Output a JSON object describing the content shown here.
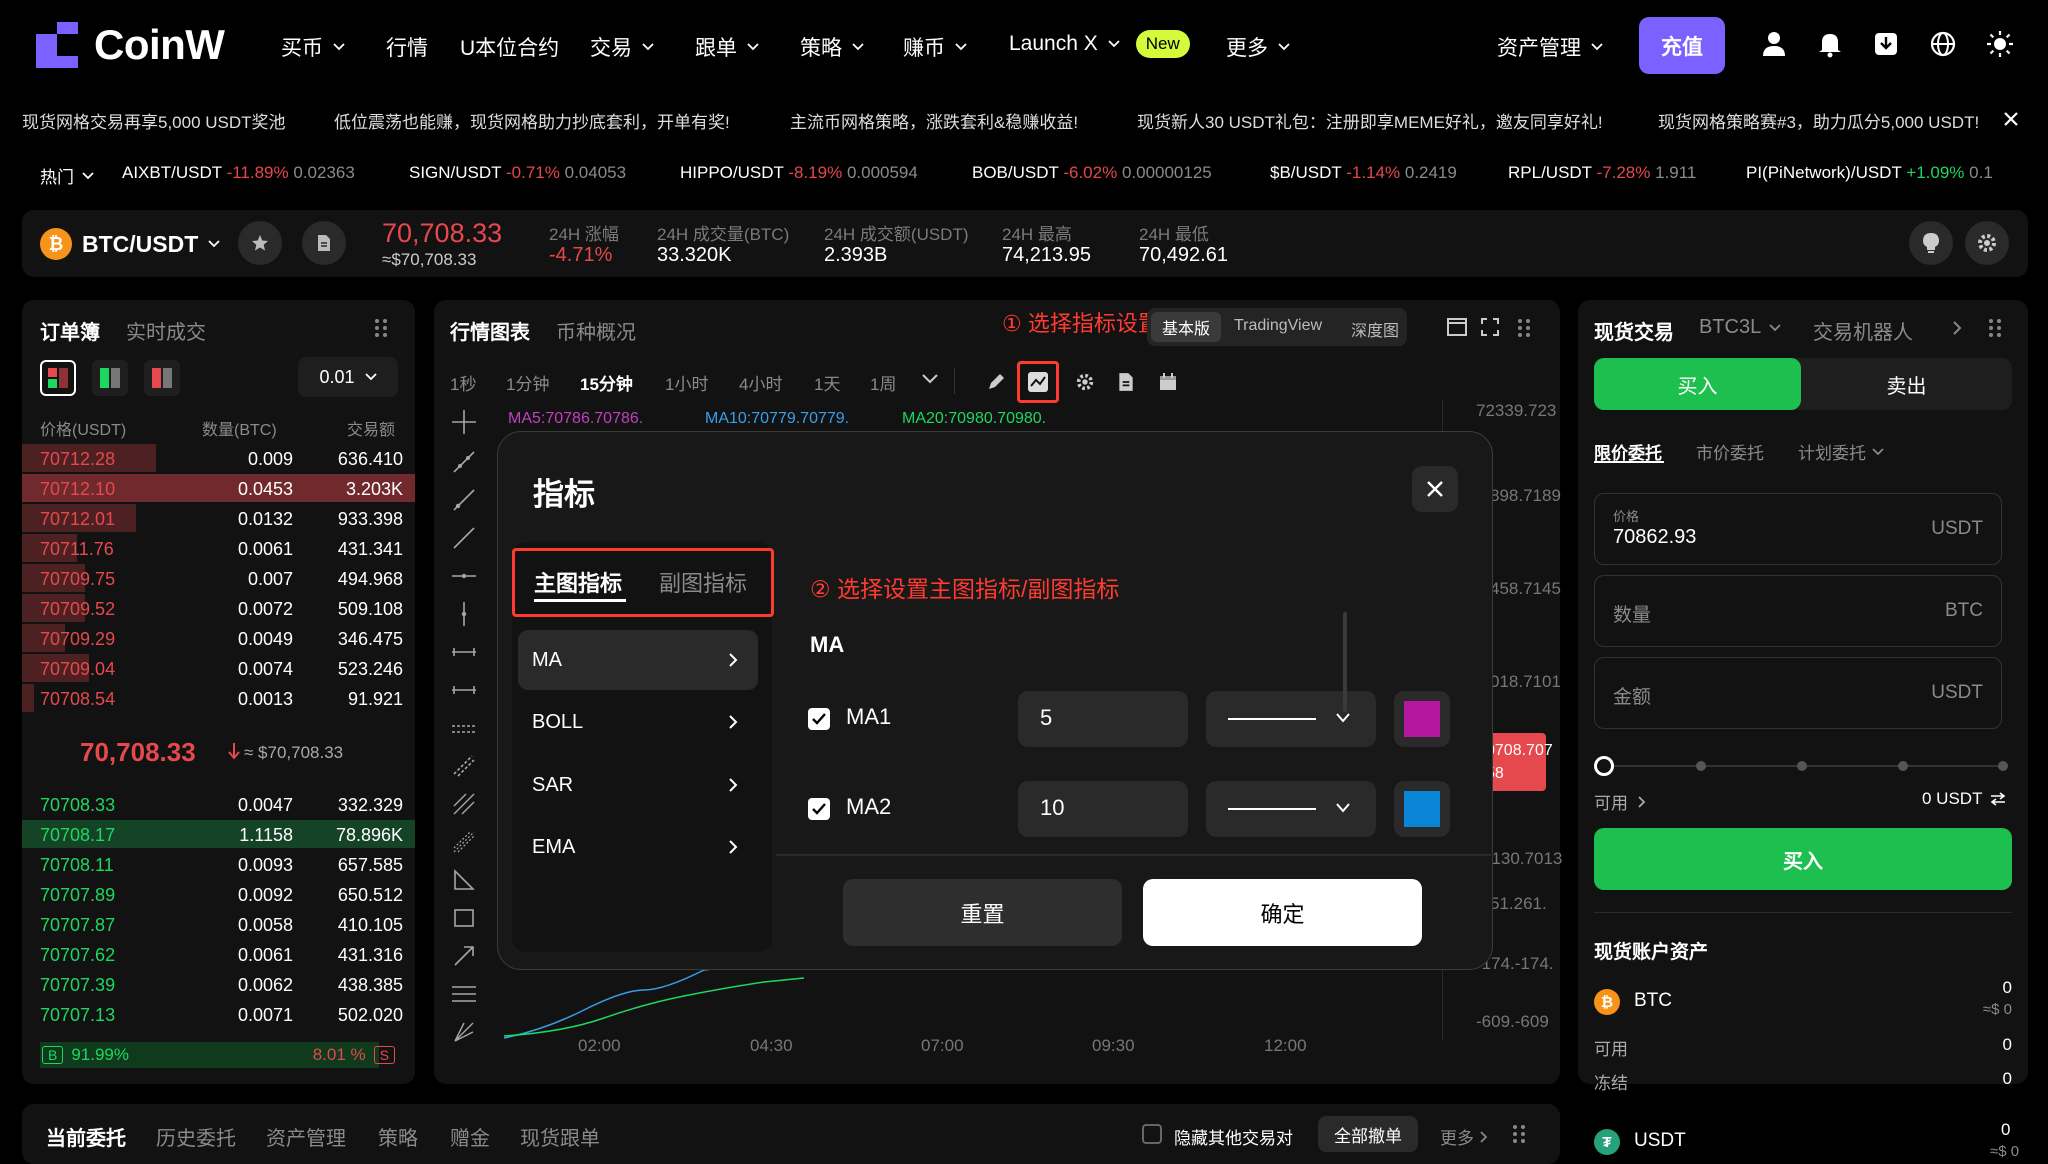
{
  "colors": {
    "accent": "#7b61ff",
    "up": "#1ed760",
    "down": "#e5484d",
    "buy": "#1dbf4f",
    "annotation": "#ff3b30",
    "new_badge": "#d4fa3c"
  },
  "nav": {
    "brand": "CoinW",
    "items": [
      {
        "label": "买币",
        "chevron": true
      },
      {
        "label": "行情",
        "chevron": false
      },
      {
        "label": "U本位合约",
        "chevron": false
      },
      {
        "label": "交易",
        "chevron": true
      },
      {
        "label": "跟单",
        "chevron": true
      },
      {
        "label": "策略",
        "chevron": true
      },
      {
        "label": "赚币",
        "chevron": true
      },
      {
        "label": "Launch X",
        "chevron": true
      },
      {
        "label": "更多",
        "chevron": true
      }
    ],
    "new_badge": "New",
    "asset_mgmt": "资产管理",
    "deposit": "充值",
    "icons": [
      "user-icon",
      "bell-icon",
      "download-icon",
      "globe-icon",
      "sun-icon"
    ]
  },
  "announcements": [
    "现货网格交易再享5,000 USDT奖池",
    "低位震荡也能赚，现货网格助力抄底套利，开单有奖!",
    "主流币网格策略，涨跌套利&稳赚收益!",
    "现货新人30 USDT礼包：注册即享MEME好礼，邀友同享好礼!",
    "现货网格策略赛#3，助力瓜分5,000 USDT!"
  ],
  "hot": {
    "label": "热门",
    "items": [
      {
        "pair": "AIXBT/USDT",
        "change": "-11.89%",
        "price": "0.02363",
        "up": false
      },
      {
        "pair": "SIGN/USDT",
        "change": "-0.71%",
        "price": "0.04053",
        "up": false
      },
      {
        "pair": "HIPPO/USDT",
        "change": "-8.19%",
        "price": "0.000594",
        "up": false
      },
      {
        "pair": "BOB/USDT",
        "change": "-6.02%",
        "price": "0.00000125",
        "up": false
      },
      {
        "pair": "$B/USDT",
        "change": "-1.14%",
        "price": "0.2419",
        "up": false
      },
      {
        "pair": "RPL/USDT",
        "change": "-7.28%",
        "price": "1.911",
        "up": false
      },
      {
        "pair": "PI(PiNetwork)/USDT",
        "change": "+1.09%",
        "price": "0.1",
        "up": true
      }
    ]
  },
  "pair": {
    "symbol": "BTC/USDT",
    "coin_glyph": "₿",
    "price": "70,708.33",
    "price_sub": "≈$70,708.33",
    "stats": [
      {
        "label": "24H 涨幅",
        "value": "-4.71%",
        "color": "down"
      },
      {
        "label": "24H 成交量(BTC)",
        "value": "33.320K",
        "color": "none"
      },
      {
        "label": "24H 成交额(USDT)",
        "value": "2.393B",
        "color": "none"
      },
      {
        "label": "24H 最高",
        "value": "74,213.95",
        "color": "none"
      },
      {
        "label": "24H 最低",
        "value": "70,492.61",
        "color": "none"
      }
    ]
  },
  "orderbook": {
    "tabs": [
      "订单簿",
      "实时成交"
    ],
    "precision": "0.01",
    "headers": [
      "价格(USDT)",
      "数量(BTC)",
      "交易额"
    ],
    "asks": [
      {
        "price": "70712.28",
        "qty": "0.009",
        "amount": "636.410",
        "depth": 0.34
      },
      {
        "price": "70712.10",
        "qty": "0.0453",
        "amount": "3.203K",
        "depth": 1.0
      },
      {
        "price": "70712.01",
        "qty": "0.0132",
        "amount": "933.398",
        "depth": 0.29
      },
      {
        "price": "70711.76",
        "qty": "0.0061",
        "amount": "431.341",
        "depth": 0.14
      },
      {
        "price": "70709.75",
        "qty": "0.007",
        "amount": "494.968",
        "depth": 0.16
      },
      {
        "price": "70709.52",
        "qty": "0.0072",
        "amount": "509.108",
        "depth": 0.16
      },
      {
        "price": "70709.29",
        "qty": "0.0049",
        "amount": "346.475",
        "depth": 0.11
      },
      {
        "price": "70709.04",
        "qty": "0.0074",
        "amount": "523.246",
        "depth": 0.17
      },
      {
        "price": "70708.54",
        "qty": "0.0013",
        "amount": "91.921",
        "depth": 0.03
      }
    ],
    "mid_price": "70,708.33",
    "mid_sub": "≈ $70,708.33",
    "bids": [
      {
        "price": "70708.33",
        "qty": "0.0047",
        "amount": "332.329",
        "depth": 0.0
      },
      {
        "price": "70708.17",
        "qty": "1.1158",
        "amount": "78.896K",
        "depth": 1.0
      },
      {
        "price": "70708.11",
        "qty": "0.0093",
        "amount": "657.585",
        "depth": 0.0
      },
      {
        "price": "70707.89",
        "qty": "0.0092",
        "amount": "650.512",
        "depth": 0.0
      },
      {
        "price": "70707.87",
        "qty": "0.0058",
        "amount": "410.105",
        "depth": 0.0
      },
      {
        "price": "70707.62",
        "qty": "0.0061",
        "amount": "431.316",
        "depth": 0.0
      },
      {
        "price": "70707.39",
        "qty": "0.0062",
        "amount": "438.385",
        "depth": 0.0
      },
      {
        "price": "70707.13",
        "qty": "0.0071",
        "amount": "502.020",
        "depth": 0.0
      }
    ],
    "buy_tag": "B",
    "buy_pct": "91.99%",
    "sell_pct": "8.01 %",
    "sell_tag": "S"
  },
  "chart": {
    "tabs": [
      "行情图表",
      "币种概况"
    ],
    "modes": [
      "基本版",
      "TradingView",
      "深度图"
    ],
    "annotation1": "① 选择指标设置",
    "timeframes": [
      "1秒",
      "1分钟",
      "15分钟",
      "1小时",
      "4小时",
      "1天",
      "1周"
    ],
    "active_tf": "15分钟",
    "ma_labels": [
      {
        "text": "MA5:70786.70786.",
        "color": "#c040c0"
      },
      {
        "text": "MA10:70779.70779.",
        "color": "#3a9ee8"
      },
      {
        "text": "MA20:70980.70980.",
        "color": "#1ed760"
      }
    ],
    "price_axis": [
      "72339.723",
      "898.7189",
      "458.7145",
      "018.7101",
      "0130.7013",
      "51.261.",
      "-174.-174.",
      "-609.-609"
    ],
    "last_price_tag": [
      "0708.707",
      "58"
    ],
    "time_axis": [
      "02:00",
      "04:30",
      "07:00",
      "09:30",
      "12:00"
    ]
  },
  "modal": {
    "title": "指标",
    "tabs": [
      "主图指标",
      "副图指标"
    ],
    "annotation2": "② 选择设置主图指标/副图指标",
    "list": [
      "MA",
      "BOLL",
      "SAR",
      "EMA"
    ],
    "section": "MA",
    "rows": [
      {
        "name": "MA1",
        "period": "5",
        "color": "#b5179e",
        "checked": true
      },
      {
        "name": "MA2",
        "period": "10",
        "color": "#0a84d6",
        "checked": true
      }
    ],
    "reset": "重置",
    "confirm": "确定"
  },
  "trade": {
    "tabs": [
      "现货交易",
      "BTC3L",
      "交易机器人"
    ],
    "buy": "买入",
    "sell": "卖出",
    "order_types": [
      "限价委托",
      "市价委托",
      "计划委托"
    ],
    "price_label": "价格",
    "price_value": "70862.93",
    "price_unit": "USDT",
    "qty_placeholder": "数量",
    "qty_unit": "BTC",
    "amount_placeholder": "金额",
    "amount_unit": "USDT",
    "available_label": "可用",
    "available_value": "0 USDT",
    "submit": "买入",
    "assets_title": "现货账户资产",
    "btc": {
      "name": "BTC",
      "value": "0",
      "usd": "≈$ 0",
      "avail_label": "可用",
      "avail": "0",
      "frozen_label": "冻结",
      "frozen": "0"
    },
    "usdt": {
      "name": "USDT",
      "value": "0",
      "usd": "≈$ 0"
    }
  },
  "bottom": {
    "tabs": [
      "当前委托",
      "历史委托",
      "资产管理",
      "策略",
      "赠金",
      "现货跟单"
    ],
    "hide_pairs": "隐藏其他交易对",
    "cancel_all": "全部撤单",
    "more": "更多"
  }
}
